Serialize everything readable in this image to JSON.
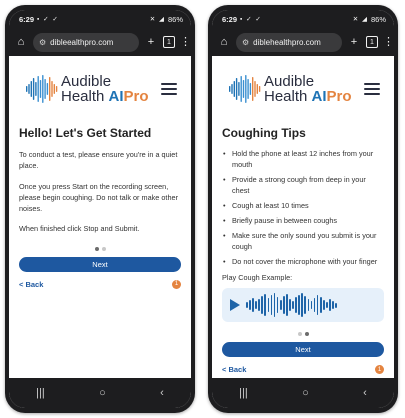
{
  "phones": [
    {
      "status": {
        "time": "6:29",
        "left_icons": "▪ ✓ ✓",
        "right_icons": "✕ ◢",
        "battery": "86%"
      },
      "browser": {
        "url": "dibleealthpro.com",
        "tab_count": "1"
      },
      "brand": {
        "line1": "Audible",
        "line2_a": "Health ",
        "line2_b": "AI",
        "line2_c": "Pro"
      },
      "page": {
        "title": "Hello! Let's Get Started",
        "paragraphs": [
          "To conduct a test, please ensure you're in a quiet place.",
          "Once you press Start on the recording screen, please begin coughing. Do not talk or make other noises.",
          "When finished click Stop and Submit."
        ]
      },
      "pagination": {
        "active_index": 1,
        "count": 2
      },
      "next_label": "Next",
      "back_label": "< Back",
      "badge_count": "1"
    },
    {
      "status": {
        "time": "6:29",
        "left_icons": "▪ ✓ ✓",
        "right_icons": "✕ ◢",
        "battery": "86%"
      },
      "browser": {
        "url": "diblehealthpro.com",
        "tab_count": "1"
      },
      "brand": {
        "line1": "Audible",
        "line2_a": "Health ",
        "line2_b": "AI",
        "line2_c": "Pro"
      },
      "page": {
        "title": "Coughing Tips",
        "tips": [
          "Hold the phone at least 12 inches from your mouth",
          "Provide a strong cough from deep in your chest",
          "Cough at least 10 times",
          "Briefly pause in between coughs",
          "Make sure the only sound you submit is your cough",
          "Do not cover the microphone with your finger"
        ],
        "play_label": "Play Cough Example:"
      },
      "pagination": {
        "active_index": 2,
        "count": 2
      },
      "next_label": "Next",
      "back_label": "< Back",
      "badge_count": "1"
    }
  ],
  "icons": {
    "home": "home-icon",
    "tune": "tune-icon",
    "new_tab": "plus-icon",
    "tabs": "tab-switcher-icon",
    "menu": "kebab-menu-icon",
    "hamburger": "hamburger-menu-icon",
    "play": "play-icon",
    "nav_recent": "recent-apps-icon",
    "nav_home": "nav-home-icon",
    "nav_back": "nav-back-icon"
  },
  "colors": {
    "brand_blue": "#1e58a0",
    "brand_orange": "#e48440",
    "player_bg": "#e6f0fa"
  }
}
